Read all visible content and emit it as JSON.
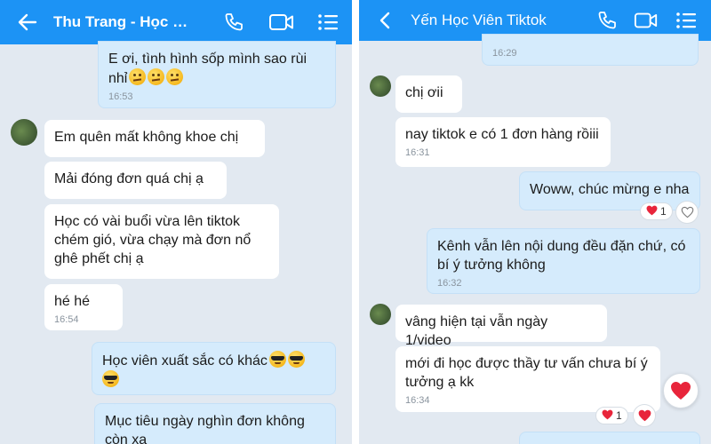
{
  "left_chat": {
    "header": {
      "title": "Thu Trang - Học vi..."
    },
    "messages": [
      {
        "text": "E ơi, tình hình sốp mình sao rùi nhỉ",
        "time": "16:53"
      },
      {
        "text": "Em quên mất không khoe chị"
      },
      {
        "text": "Mải đóng đơn quá chị ạ"
      },
      {
        "text": "Học có vài buổi vừa lên tiktok chém gió, vừa chạy mà đơn nổ ghê phết chị ạ"
      },
      {
        "text": "hé hé",
        "time": "16:54"
      },
      {
        "text": "Học viên xuất sắc có khác"
      },
      {
        "text": "Mục tiêu ngày nghìn đơn không còn xa"
      }
    ]
  },
  "right_chat": {
    "header": {
      "title": "Yến Học Viên Tiktok"
    },
    "messages": [
      {
        "time": "16:29"
      },
      {
        "text": "chị ơii"
      },
      {
        "text": "nay tiktok e có 1 đơn hàng rồiii",
        "time": "16:31"
      },
      {
        "text": "Woww, chúc mừng e nha",
        "reaction_count": "1"
      },
      {
        "text": "Kênh vẫn lên nội dung đều đặn chứ, có bí ý tưởng không",
        "time": "16:32"
      },
      {
        "text": "vâng hiện tại vẫn ngày 1/video"
      },
      {
        "text": "mới đi học được thầy tư vấn chưa bí ý tưởng ạ kk",
        "time": "16:34",
        "reaction_count": "1"
      }
    ]
  },
  "colors": {
    "header": "#1c93f5",
    "chat_bg": "#e2e9f1",
    "outgoing": "#d5ebfc",
    "incoming": "#ffffff",
    "heart": "#e8253b"
  }
}
